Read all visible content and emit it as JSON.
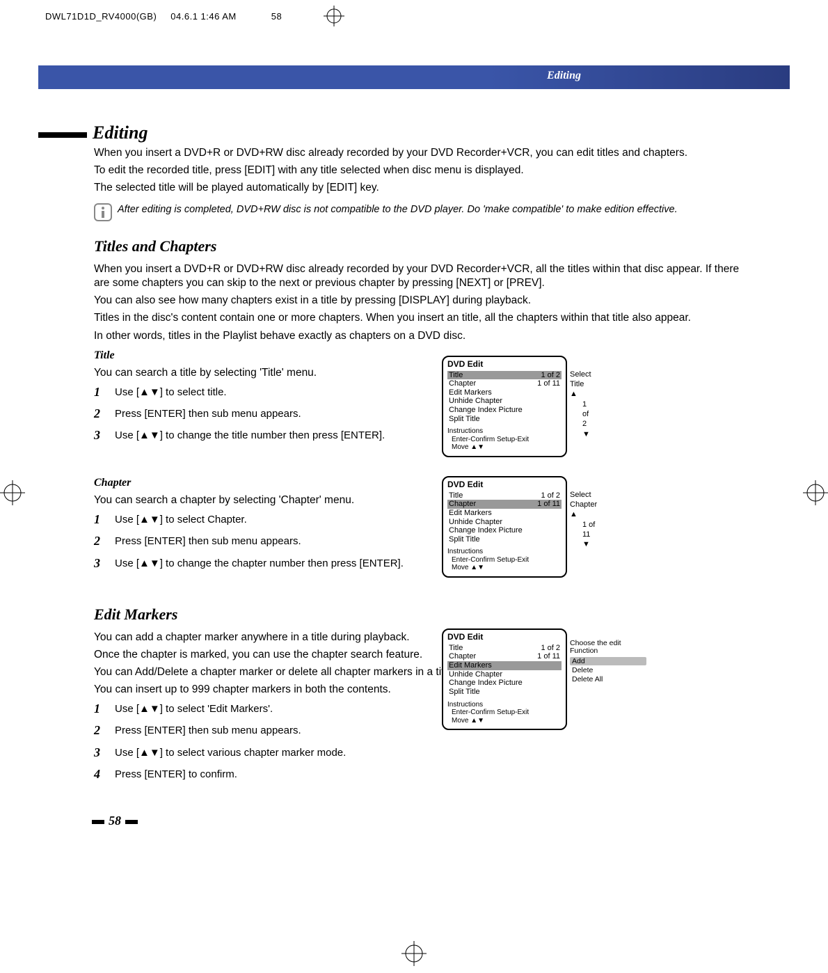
{
  "print_header": {
    "filename": "DWL71D1D_RV4000(GB)",
    "timestamp": "04.6.1 1:46 AM",
    "page_marker": "58"
  },
  "header_label": "Editing",
  "section_title": "Editing",
  "intro": {
    "p1": "When you insert a DVD+R or DVD+RW disc already recorded by your DVD Recorder+VCR, you can edit titles and chapters.",
    "p2": "To edit the recorded title, press [EDIT] with any title selected when disc menu is displayed.",
    "p3": "The selected title will be played automatically by [EDIT] key.",
    "note": "After editing is completed, DVD+RW disc is not compatible to the DVD player. Do 'make compatible' to make edition effective."
  },
  "titles_chapters": {
    "heading": "Titles and Chapters",
    "p1": "When you insert a DVD+R or DVD+RW disc already recorded by your DVD Recorder+VCR, all the titles within that disc appear. If there are some chapters you can skip to the next or previous chapter by pressing [NEXT] or [PREV].",
    "p2": "You can also see how many chapters exist in a title by pressing [DISPLAY] during playback.",
    "p3": "Titles in the disc's content contain one or more chapters. When you insert an title, all the chapters within that title also appear.",
    "p4": "In other words, titles in the Playlist behave exactly as chapters on a DVD disc."
  },
  "title_section": {
    "heading": "Title",
    "intro": "You can search a title by selecting 'Title' menu.",
    "steps": [
      "Use [▲▼] to select title.",
      "Press [ENTER] then sub menu appears.",
      "Use [▲▼] to change the title number then press [ENTER]."
    ]
  },
  "chapter_section": {
    "heading": "Chapter",
    "intro": "You can search a chapter by selecting 'Chapter' menu.",
    "steps": [
      "Use [▲▼] to select Chapter.",
      "Press [ENTER] then sub menu appears.",
      "Use [▲▼] to change the chapter number then press [ENTER]."
    ]
  },
  "edit_markers": {
    "heading": "Edit Markers",
    "p1": "You can add a chapter marker anywhere in a title during playback.",
    "p2": "Once the chapter is marked, you can use the chapter search feature.",
    "p3": "You can Add/Delete a chapter marker or delete all chapter markers in a title.",
    "p4": "You can insert up to 999 chapter markers in both the  contents.",
    "steps": [
      "Use [▲▼] to select 'Edit Markers'.",
      "Press [ENTER] then sub menu appears.",
      "Use [▲▼] to select various chapter marker mode.",
      "Press [ENTER] to confirm."
    ]
  },
  "panel_common": {
    "title": "DVD Edit",
    "items": [
      "Title",
      "Chapter",
      "Edit Markers",
      "Unhide Chapter",
      "Change Index Picture",
      "Split Title"
    ],
    "title_value": "1 of 2",
    "chapter_value": "1 of 11",
    "instr_label": "Instructions",
    "instr1": "Enter-Confirm   Setup-Exit",
    "instr2": "Move ▲▼"
  },
  "panel1_side": {
    "label": "Select Title",
    "value": "1 of 2"
  },
  "panel2_side": {
    "label": "Select Chapter",
    "value": "1 of 11"
  },
  "panel3_side": {
    "label": "Choose the edit Function",
    "options": [
      "Add",
      "Delete",
      "Delete All"
    ]
  },
  "page_number": "58"
}
